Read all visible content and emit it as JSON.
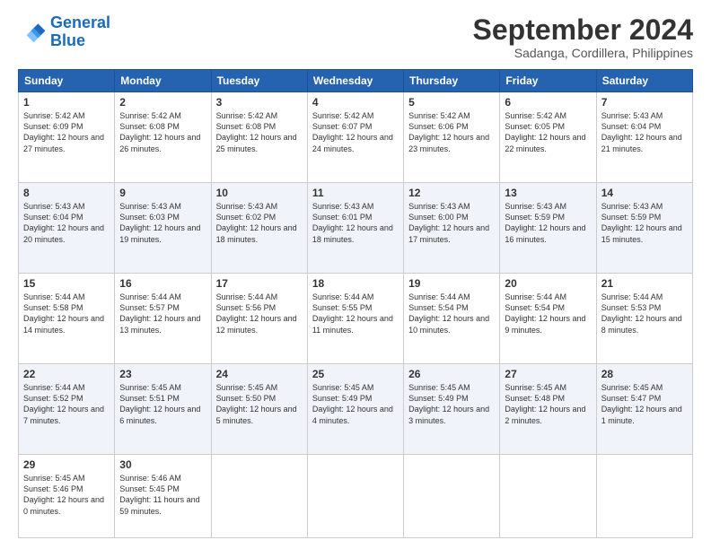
{
  "logo": {
    "line1": "General",
    "line2": "Blue"
  },
  "title": "September 2024",
  "location": "Sadanga, Cordillera, Philippines",
  "days_of_week": [
    "Sunday",
    "Monday",
    "Tuesday",
    "Wednesday",
    "Thursday",
    "Friday",
    "Saturday"
  ],
  "weeks": [
    [
      {
        "day": "1",
        "sunrise": "5:42 AM",
        "sunset": "6:09 PM",
        "daylight": "12 hours and 27 minutes."
      },
      {
        "day": "2",
        "sunrise": "5:42 AM",
        "sunset": "6:08 PM",
        "daylight": "12 hours and 26 minutes."
      },
      {
        "day": "3",
        "sunrise": "5:42 AM",
        "sunset": "6:08 PM",
        "daylight": "12 hours and 25 minutes."
      },
      {
        "day": "4",
        "sunrise": "5:42 AM",
        "sunset": "6:07 PM",
        "daylight": "12 hours and 24 minutes."
      },
      {
        "day": "5",
        "sunrise": "5:42 AM",
        "sunset": "6:06 PM",
        "daylight": "12 hours and 23 minutes."
      },
      {
        "day": "6",
        "sunrise": "5:42 AM",
        "sunset": "6:05 PM",
        "daylight": "12 hours and 22 minutes."
      },
      {
        "day": "7",
        "sunrise": "5:43 AM",
        "sunset": "6:04 PM",
        "daylight": "12 hours and 21 minutes."
      }
    ],
    [
      {
        "day": "8",
        "sunrise": "5:43 AM",
        "sunset": "6:04 PM",
        "daylight": "12 hours and 20 minutes."
      },
      {
        "day": "9",
        "sunrise": "5:43 AM",
        "sunset": "6:03 PM",
        "daylight": "12 hours and 19 minutes."
      },
      {
        "day": "10",
        "sunrise": "5:43 AM",
        "sunset": "6:02 PM",
        "daylight": "12 hours and 18 minutes."
      },
      {
        "day": "11",
        "sunrise": "5:43 AM",
        "sunset": "6:01 PM",
        "daylight": "12 hours and 18 minutes."
      },
      {
        "day": "12",
        "sunrise": "5:43 AM",
        "sunset": "6:00 PM",
        "daylight": "12 hours and 17 minutes."
      },
      {
        "day": "13",
        "sunrise": "5:43 AM",
        "sunset": "5:59 PM",
        "daylight": "12 hours and 16 minutes."
      },
      {
        "day": "14",
        "sunrise": "5:43 AM",
        "sunset": "5:59 PM",
        "daylight": "12 hours and 15 minutes."
      }
    ],
    [
      {
        "day": "15",
        "sunrise": "5:44 AM",
        "sunset": "5:58 PM",
        "daylight": "12 hours and 14 minutes."
      },
      {
        "day": "16",
        "sunrise": "5:44 AM",
        "sunset": "5:57 PM",
        "daylight": "12 hours and 13 minutes."
      },
      {
        "day": "17",
        "sunrise": "5:44 AM",
        "sunset": "5:56 PM",
        "daylight": "12 hours and 12 minutes."
      },
      {
        "day": "18",
        "sunrise": "5:44 AM",
        "sunset": "5:55 PM",
        "daylight": "12 hours and 11 minutes."
      },
      {
        "day": "19",
        "sunrise": "5:44 AM",
        "sunset": "5:54 PM",
        "daylight": "12 hours and 10 minutes."
      },
      {
        "day": "20",
        "sunrise": "5:44 AM",
        "sunset": "5:54 PM",
        "daylight": "12 hours and 9 minutes."
      },
      {
        "day": "21",
        "sunrise": "5:44 AM",
        "sunset": "5:53 PM",
        "daylight": "12 hours and 8 minutes."
      }
    ],
    [
      {
        "day": "22",
        "sunrise": "5:44 AM",
        "sunset": "5:52 PM",
        "daylight": "12 hours and 7 minutes."
      },
      {
        "day": "23",
        "sunrise": "5:45 AM",
        "sunset": "5:51 PM",
        "daylight": "12 hours and 6 minutes."
      },
      {
        "day": "24",
        "sunrise": "5:45 AM",
        "sunset": "5:50 PM",
        "daylight": "12 hours and 5 minutes."
      },
      {
        "day": "25",
        "sunrise": "5:45 AM",
        "sunset": "5:49 PM",
        "daylight": "12 hours and 4 minutes."
      },
      {
        "day": "26",
        "sunrise": "5:45 AM",
        "sunset": "5:49 PM",
        "daylight": "12 hours and 3 minutes."
      },
      {
        "day": "27",
        "sunrise": "5:45 AM",
        "sunset": "5:48 PM",
        "daylight": "12 hours and 2 minutes."
      },
      {
        "day": "28",
        "sunrise": "5:45 AM",
        "sunset": "5:47 PM",
        "daylight": "12 hours and 1 minute."
      }
    ],
    [
      {
        "day": "29",
        "sunrise": "5:45 AM",
        "sunset": "5:46 PM",
        "daylight": "12 hours and 0 minutes."
      },
      {
        "day": "30",
        "sunrise": "5:46 AM",
        "sunset": "5:45 PM",
        "daylight": "11 hours and 59 minutes."
      },
      null,
      null,
      null,
      null,
      null
    ]
  ]
}
